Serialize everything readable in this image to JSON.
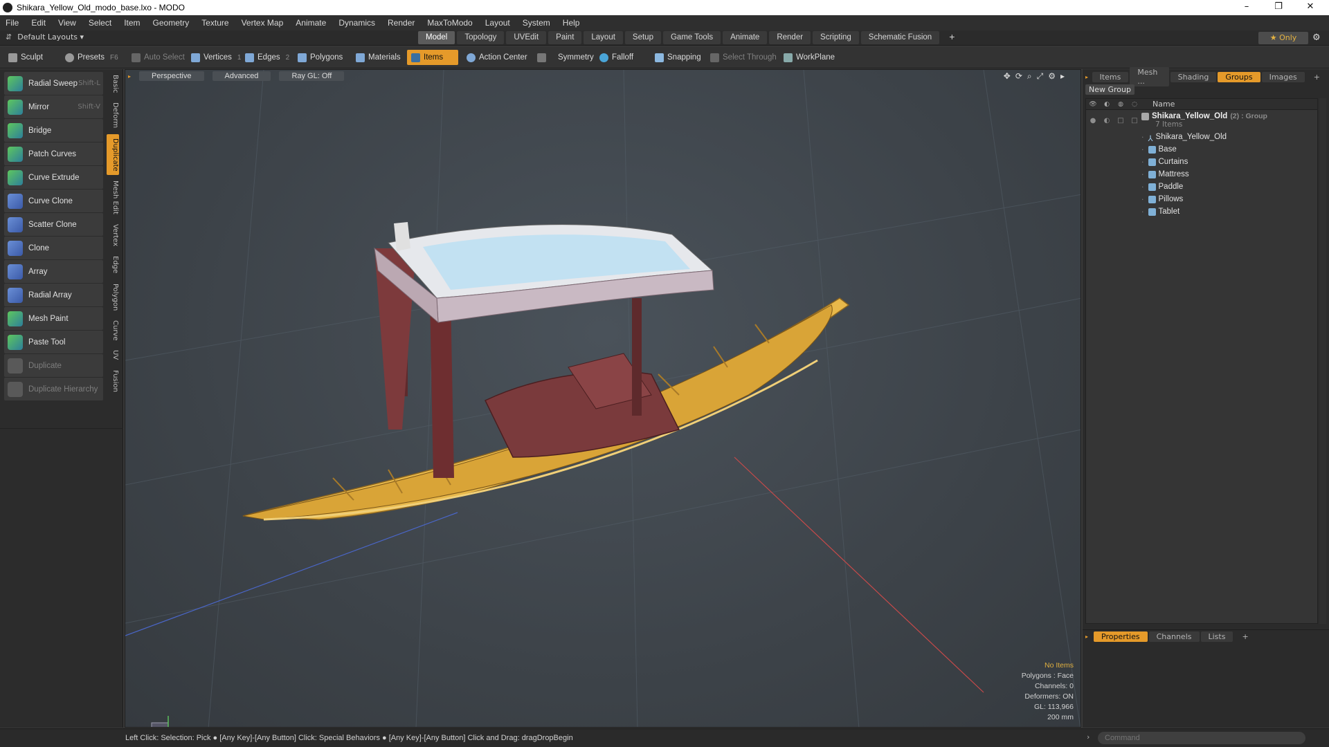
{
  "window": {
    "title": "Shikara_Yellow_Old_modo_base.lxo - MODO",
    "min": "–",
    "restore": "❐",
    "close": "✕"
  },
  "menu": [
    "File",
    "Edit",
    "View",
    "Select",
    "Item",
    "Geometry",
    "Texture",
    "Vertex Map",
    "Animate",
    "Dynamics",
    "Render",
    "MaxToModo",
    "Layout",
    "System",
    "Help"
  ],
  "layouts": {
    "label": "Default Layouts ▾",
    "tabs": [
      "Model",
      "Topology",
      "UVEdit",
      "Paint",
      "Layout",
      "Setup",
      "Game Tools",
      "Animate",
      "Render",
      "Scripting",
      "Schematic Fusion",
      "+"
    ],
    "only": "★ Only"
  },
  "toolbar": {
    "sculpt": "Sculpt",
    "presets": "Presets",
    "presets_key": "F6",
    "auto_select": "Auto Select",
    "vertices": "Vertices",
    "vertices_num": "1",
    "edges": "Edges",
    "edges_num": "2",
    "polygons": "Polygons",
    "materials": "Materials",
    "items": "Items",
    "action_center": "Action Center",
    "symmetry": "Symmetry",
    "falloff": "Falloff",
    "snapping": "Snapping",
    "select_through": "Select Through",
    "workplane": "WorkPlane"
  },
  "tools": [
    {
      "label": "Radial Sweep",
      "key": "Shift-L"
    },
    {
      "label": "Mirror",
      "key": "Shift-V"
    },
    {
      "label": "Bridge",
      "key": ""
    },
    {
      "label": "Patch Curves",
      "key": ""
    },
    {
      "label": "Curve Extrude",
      "key": ""
    },
    {
      "label": "Curve Clone",
      "key": ""
    },
    {
      "label": "Scatter Clone",
      "key": ""
    },
    {
      "label": "Clone",
      "key": ""
    },
    {
      "label": "Array",
      "key": ""
    },
    {
      "label": "Radial Array",
      "key": ""
    },
    {
      "label": "Mesh Paint",
      "key": ""
    },
    {
      "label": "Paste Tool",
      "key": ""
    },
    {
      "label": "Duplicate",
      "key": ""
    },
    {
      "label": "Duplicate Hierarchy",
      "key": ""
    }
  ],
  "side_tabs": [
    "Basic",
    "Deform",
    "Duplicate",
    "Mesh Edit",
    "Vertex",
    "Edge",
    "Polygon",
    "Curve",
    "UV",
    "Fusion"
  ],
  "viewport": {
    "perspective": "Perspective",
    "advanced": "Advanced",
    "raygl": "Ray GL: Off",
    "info": {
      "items": "No Items",
      "polygons": "Polygons : Face",
      "channels": "Channels: 0",
      "deformers": "Deformers: ON",
      "gl": "GL: 113,966",
      "scale": "200 mm"
    }
  },
  "right_panel": {
    "tabs": [
      "Items",
      "Mesh ...",
      "Shading",
      "Groups",
      "Images",
      "+"
    ],
    "new_group": "New Group",
    "name_header": "Name",
    "group": {
      "name": "Shikara_Yellow_Old",
      "suffix": "(2) : Group",
      "count": "7 Items"
    },
    "children": [
      "Shikara_Yellow_Old",
      "Base",
      "Curtains",
      "Mattress",
      "Paddle",
      "Pillows",
      "Tablet"
    ],
    "props_tabs": [
      "Properties",
      "Channels",
      "Lists",
      "+"
    ]
  },
  "status": {
    "message": "Left Click: Selection: Pick ● [Any Key]-[Any Button] Click: Special Behaviors ● [Any Key]-[Any Button] Click and Drag: dragDropBegin",
    "command_placeholder": "Command"
  },
  "colors": {
    "accent": "#e59a2a",
    "boat": "#e8b84a",
    "canopy": "#9fd3f0"
  }
}
